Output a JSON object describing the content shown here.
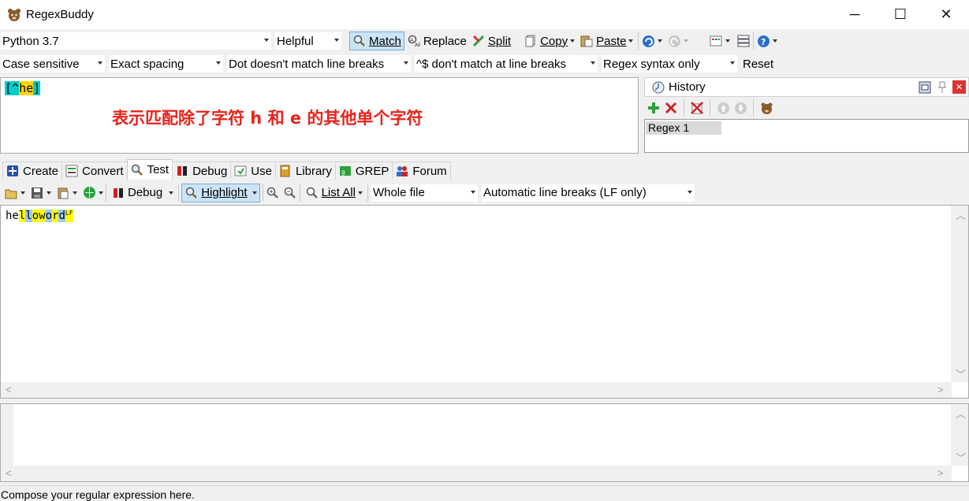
{
  "window": {
    "title": "RegexBuddy",
    "minimize": "─",
    "maximize": "☐",
    "close": "✕"
  },
  "toolbar1": {
    "flavor": "Python 3.7",
    "mode": "Helpful",
    "match": "Match",
    "replace": "Replace",
    "split": "Split",
    "copy": "Copy",
    "paste": "Paste"
  },
  "options": {
    "case": "Case sensitive",
    "spacing": "Exact spacing",
    "dot": "Dot doesn't match line breaks",
    "anchors": "^$ don't match at line breaks",
    "syntax": "Regex syntax only",
    "reset": "Reset"
  },
  "regex": {
    "open": "[",
    "caret": "^",
    "chars": "he",
    "close": "]",
    "annotation": "表示匹配除了字符 h 和 e 的其他单个字符"
  },
  "history": {
    "title": "History",
    "items": [
      "Regex 1"
    ]
  },
  "tabs": [
    "Create",
    "Convert",
    "Test",
    "Debug",
    "Use",
    "Library",
    "GREP",
    "Forum"
  ],
  "test_toolbar": {
    "debug": "Debug",
    "highlight": "Highlight",
    "list_all": "List All",
    "scope": "Whole file",
    "line_breaks": "Automatic line breaks (LF only)"
  },
  "test_subject": {
    "plain": "he",
    "segments": [
      "l",
      "l",
      "o",
      " ",
      "w",
      "o",
      "r",
      "d"
    ],
    "linefeed": "LF"
  },
  "status": "Compose your regular expression here.",
  "colors": {
    "accent_red": "#e8231b",
    "highlight_yellow": "#ffff00",
    "highlight_blue": "#99ccff",
    "regex_bracket": "#00cccc"
  }
}
